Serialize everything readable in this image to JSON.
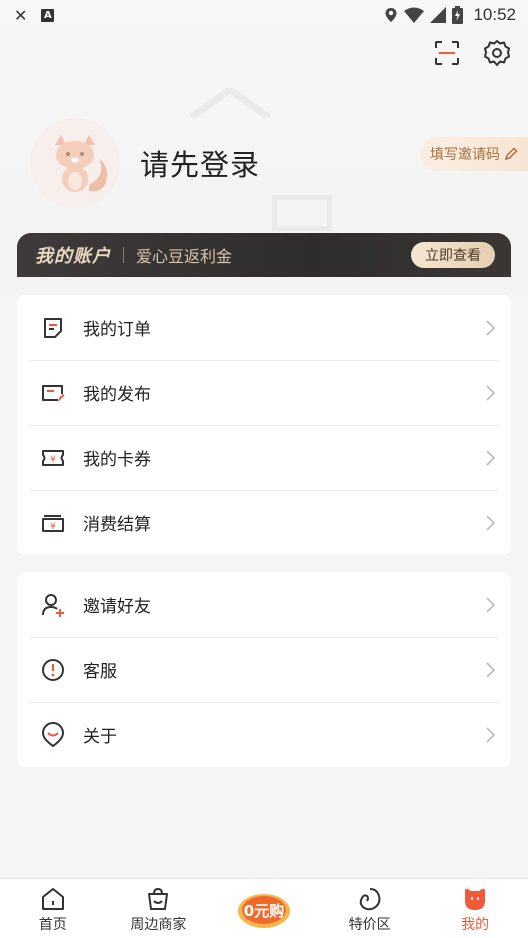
{
  "status_bar": {
    "left_icons": [
      "close-icon",
      "a-icon"
    ],
    "a_glyph": "A",
    "time": "10:52"
  },
  "header": {
    "title": "请先登录",
    "invite_label": "填写邀请码"
  },
  "account": {
    "title": "我的账户",
    "subtitle": "爱心豆返利金",
    "button": "立即查看"
  },
  "menu_group_1": [
    {
      "label": "我的订单",
      "icon": "order-icon"
    },
    {
      "label": "我的发布",
      "icon": "publish-icon"
    },
    {
      "label": "我的卡券",
      "icon": "coupon-icon"
    },
    {
      "label": "消费结算",
      "icon": "settlement-icon"
    }
  ],
  "menu_group_2": [
    {
      "label": "邀请好友",
      "icon": "invite-friend-icon"
    },
    {
      "label": "客服",
      "icon": "customer-service-icon"
    },
    {
      "label": "关于",
      "icon": "about-icon"
    }
  ],
  "tabbar": {
    "items": [
      {
        "label": "首页",
        "icon": "home-icon"
      },
      {
        "label": "周边商家",
        "icon": "shop-icon"
      },
      {
        "label": "0元购",
        "icon": "zero-yuan-badge"
      },
      {
        "label": "特价区",
        "icon": "special-price-icon"
      },
      {
        "label": "我的",
        "icon": "mine-icon"
      }
    ],
    "active_index": 4
  },
  "colors": {
    "accent": "#ef5a3c",
    "account_gold": "#e8d6bf"
  }
}
